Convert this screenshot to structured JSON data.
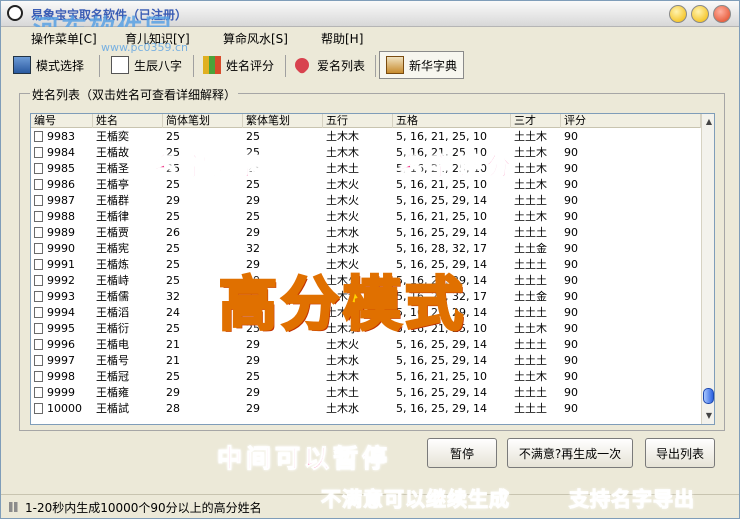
{
  "titlebar": {
    "title": "易象宝宝取名软件（已注册）"
  },
  "watermark": {
    "logo_text": "河东软件园",
    "url": "www.pc0359.cn"
  },
  "menu": {
    "items": [
      {
        "label": "操作菜单[C]"
      },
      {
        "label": "育儿知识[Y]"
      },
      {
        "label": "算命风水[S]"
      },
      {
        "label": "帮助[H]"
      }
    ]
  },
  "toolbar": {
    "buttons": [
      {
        "label": "模式选择",
        "icon": "mode-icon"
      },
      {
        "label": "生辰八字",
        "icon": "bazi-icon"
      },
      {
        "label": "姓名评分",
        "icon": "score-icon"
      },
      {
        "label": "爱名列表",
        "icon": "heart-icon"
      },
      {
        "label": "新华字典",
        "icon": "dictionary-icon"
      }
    ]
  },
  "group": {
    "label": "姓名列表（双击姓名可查看详细解释）"
  },
  "table": {
    "headers": [
      "编号",
      "姓名",
      "简体笔划",
      "繁体笔划",
      "五行",
      "五格",
      "三才",
      "评分"
    ],
    "rows": [
      [
        "9983",
        "王楯奕",
        "25",
        "25",
        "土木木",
        "5, 16, 21, 25, 10",
        "土土木",
        "90"
      ],
      [
        "9984",
        "王楯故",
        "25",
        "25",
        "土木木",
        "5, 16, 21, 25, 10",
        "土土木",
        "90"
      ],
      [
        "9985",
        "王楯圣",
        "25",
        "25",
        "土木土",
        "5, 16, 21, 25, 10",
        "土土木",
        "90"
      ],
      [
        "9986",
        "王楯亭",
        "25",
        "25",
        "土木火",
        "5, 16, 21, 25, 10",
        "土土木",
        "90"
      ],
      [
        "9987",
        "王楯群",
        "29",
        "29",
        "土木火",
        "5, 16, 25, 29, 14",
        "土土土",
        "90"
      ],
      [
        "9988",
        "王楯律",
        "25",
        "25",
        "土木火",
        "5, 16, 21, 25, 10",
        "土土木",
        "90"
      ],
      [
        "9989",
        "王楯贾",
        "26",
        "29",
        "土木水",
        "5, 16, 25, 29, 14",
        "土土土",
        "90"
      ],
      [
        "9990",
        "王楯宪",
        "25",
        "32",
        "土木水",
        "5, 16, 28, 32, 17",
        "土土金",
        "90"
      ],
      [
        "9991",
        "王楯炼",
        "25",
        "29",
        "土木火",
        "5, 16, 25, 29, 14",
        "土土土",
        "90"
      ],
      [
        "9992",
        "王楯峙",
        "25",
        "29",
        "土木火",
        "5, 16, 25, 29, 14",
        "土土土",
        "90"
      ],
      [
        "9993",
        "王楯儒",
        "32",
        "32",
        "土木金",
        "5, 16, 28, 32, 17",
        "土土金",
        "90"
      ],
      [
        "9994",
        "王楯滔",
        "24",
        "29",
        "土木水",
        "5, 16, 25, 29, 14",
        "土土土",
        "90"
      ],
      [
        "9995",
        "王楯衍",
        "25",
        "25",
        "土木水",
        "5, 16, 21, 25, 10",
        "土土木",
        "90"
      ],
      [
        "9996",
        "王楯电",
        "21",
        "29",
        "土木火",
        "5, 16, 25, 29, 14",
        "土土土",
        "90"
      ],
      [
        "9997",
        "王楯号",
        "21",
        "29",
        "土木水",
        "5, 16, 25, 29, 14",
        "土土土",
        "90"
      ],
      [
        "9998",
        "王楯冠",
        "25",
        "25",
        "土木木",
        "5, 16, 21, 25, 10",
        "土土木",
        "90"
      ],
      [
        "9999",
        "王楯雍",
        "29",
        "29",
        "土木土",
        "5, 16, 25, 29, 14",
        "土土土",
        "90"
      ],
      [
        "10000",
        "王楯試",
        "28",
        "29",
        "土木水",
        "5, 16, 25, 29, 14",
        "土土土",
        "90"
      ]
    ]
  },
  "buttons": {
    "pause": "暂停",
    "regenerate": "不满意?再生成一次",
    "export": "导出列表"
  },
  "status": {
    "text": "1-20秒内生成10000个90分以上的高分姓名"
  },
  "annotations": {
    "name_list": "名字列表",
    "name_score": "名字评分",
    "high_score_mode": "高分模式",
    "pause_anytime": "中间可以暂停",
    "continue_generate": "不满意可以继续生成",
    "export_support": "支持名字导出"
  },
  "colors": {
    "window_bg": "#ece9d8",
    "annotation_pink": "#f03b8a",
    "annotation_orange": "#ff7a00",
    "annotation_yellow": "#ffd400"
  }
}
